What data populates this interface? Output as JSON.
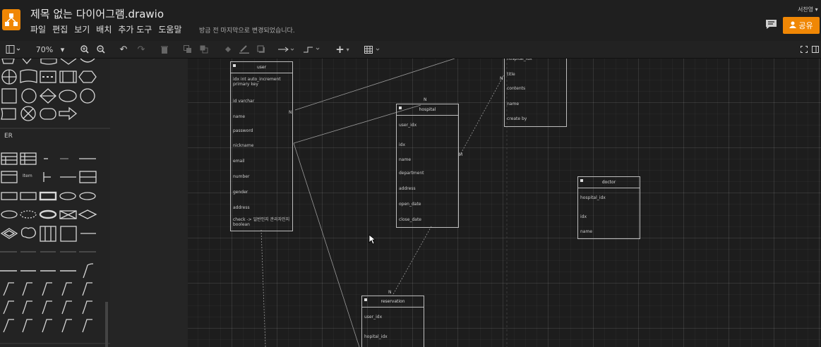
{
  "header": {
    "title": "제목 없는 다이어그램.drawio",
    "menu": [
      "파일",
      "편집",
      "보기",
      "배치",
      "추가 도구",
      "도움말"
    ],
    "status": "방금 전 마지막으로 변경되었습니다.",
    "user": "서찬영",
    "share_label": "공유"
  },
  "toolbar": {
    "zoom": "70%"
  },
  "sidebar": {
    "section": "ER",
    "item_label": "Item"
  },
  "accent_color": "#f08705",
  "tables": {
    "user": {
      "name": "user",
      "fields": [
        "idx int auto_increment primary key",
        "id varchar",
        "name",
        "password",
        "nickname",
        "email",
        "number",
        "gender",
        "address",
        "check -> 일반인지 관리자인지 boolean"
      ]
    },
    "hospital": {
      "name": "hospital",
      "fields": [
        "user_idx",
        "idx",
        "name",
        "department",
        "address",
        "open_date",
        "close_date"
      ]
    },
    "post": {
      "fields": [
        "hospital_idx",
        "title",
        "contents",
        "name",
        "create by"
      ]
    },
    "doctor": {
      "name": "doctor",
      "fields": [
        "hospital_idx",
        "idx",
        "name"
      ]
    },
    "reservation": {
      "name": "reservation",
      "fields": [
        "user_idx",
        "hopital_idx"
      ]
    }
  },
  "relation_labels": {
    "n1": "N",
    "n2": "N",
    "n3": "N",
    "m1": "M",
    "n4": "N"
  }
}
